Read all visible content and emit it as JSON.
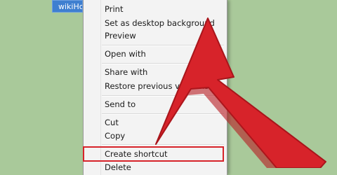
{
  "desktop": {
    "file_label": "wikiHo"
  },
  "context_menu": {
    "items": [
      {
        "label": "Print"
      },
      {
        "label": "Set as desktop background"
      },
      {
        "label": "Preview"
      },
      {
        "label": "Open with"
      },
      {
        "label": "Share with"
      },
      {
        "label": "Restore previous versions"
      },
      {
        "label": "Send to"
      },
      {
        "label": "Cut"
      },
      {
        "label": "Copy"
      },
      {
        "label": "Create shortcut"
      },
      {
        "label": "Delete"
      }
    ]
  },
  "annotation": {
    "arrow_color": "#d7232a",
    "highlight_color": "#d7232a",
    "highlighted_item": "Create shortcut"
  }
}
